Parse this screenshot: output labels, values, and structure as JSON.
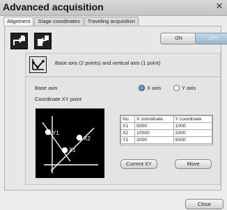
{
  "window": {
    "title": "Advanced acquisition",
    "close_icon": "close-icon"
  },
  "tabs": [
    {
      "label": "Alignment",
      "active": true
    },
    {
      "label": "Stage coordinates",
      "active": false
    },
    {
      "label": "Traveling acquisition",
      "active": false
    }
  ],
  "toolbar": {
    "icon_left": "save-export-icon",
    "icon_right": "load-import-icon"
  },
  "toggle": {
    "on_label": "ON",
    "off_label": "OFF",
    "state": "OFF"
  },
  "mode": {
    "icon": "axis-diagram-icon",
    "label": "Base axis (2 points) and vertical axis (1 point)"
  },
  "base_axis": {
    "label": "Base axis",
    "options": [
      {
        "label": "X axis",
        "checked": true
      },
      {
        "label": "Y axis",
        "checked": false
      }
    ]
  },
  "coordinate_section": {
    "title": "Coordinate XY point",
    "diagram_labels": [
      "Y1",
      "X2",
      "X1"
    ]
  },
  "coord_table": {
    "headers": [
      "No.",
      "X coordinate",
      "Y coordinate"
    ],
    "rows": [
      [
        "X1",
        "5000",
        "1000"
      ],
      [
        "X2",
        "10000",
        "2000"
      ],
      [
        "Y1",
        "2000",
        "5000"
      ]
    ]
  },
  "buttons": {
    "current_xy": "Current XY",
    "move": "Move",
    "close": "Close"
  }
}
